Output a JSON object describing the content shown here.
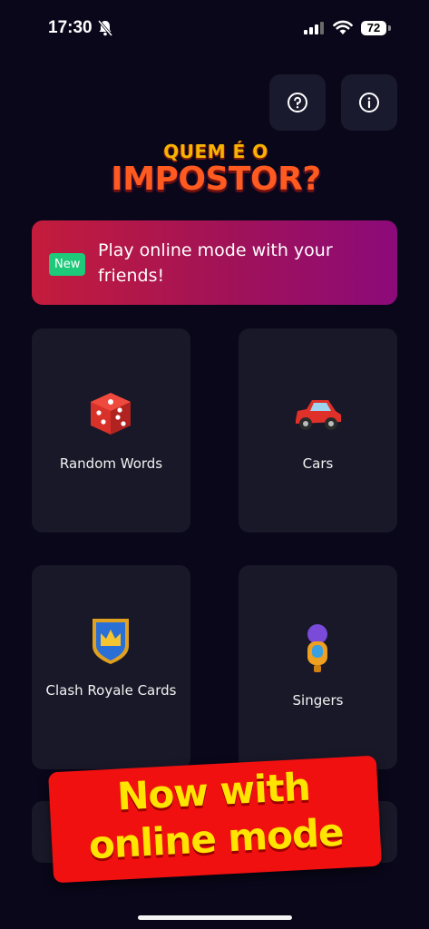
{
  "status_bar": {
    "time": "17:30",
    "battery": "72"
  },
  "logo": {
    "line1": "QUEM É O",
    "line2": "IMPOSTOR?"
  },
  "promo": {
    "badge": "New",
    "text": "Play online mode with your friends!"
  },
  "categories": [
    {
      "label": "Random Words",
      "icon": "dice-icon"
    },
    {
      "label": "Cars",
      "icon": "car-icon"
    },
    {
      "label": "Clash Royale Cards",
      "icon": "crown-shield-icon"
    },
    {
      "label": "Singers",
      "icon": "microphone-icon"
    }
  ],
  "overlay": {
    "line1": "Now with",
    "line2": "online mode"
  },
  "colors": {
    "background": "#090719",
    "card": "#181828",
    "banner_start": "#c41c3c",
    "banner_end": "#8c0a7a",
    "badge": "#1ec97a",
    "overlay": "#f01010",
    "overlay_text": "#ffe400"
  }
}
